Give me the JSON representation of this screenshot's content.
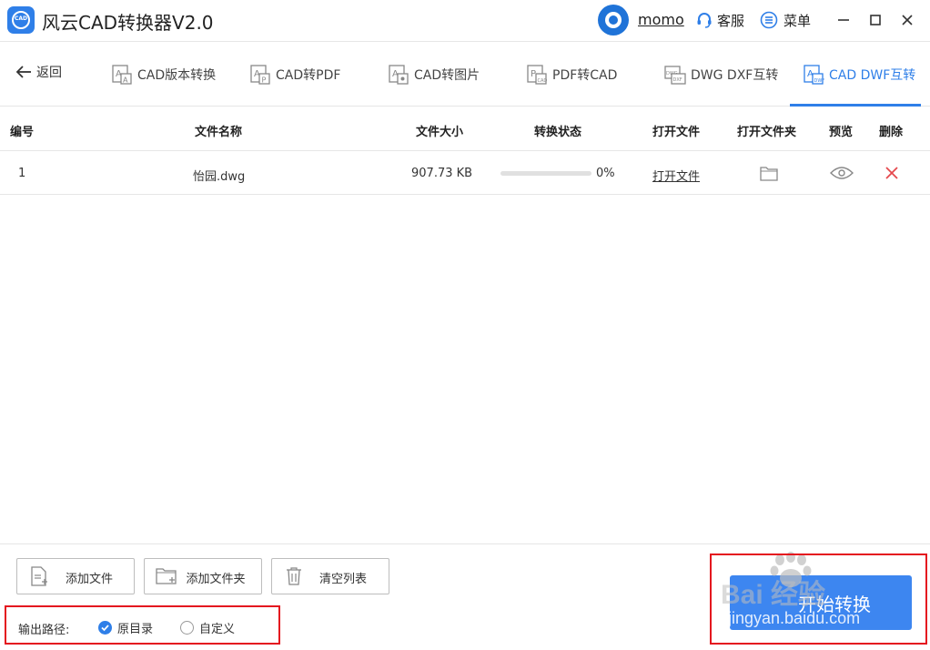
{
  "app": {
    "title": "风云CAD转换器V2.0",
    "logo_text": "CAD",
    "username": "momo",
    "service_label": "客服",
    "menu_label": "菜单",
    "accent_color": "#2f7fe8"
  },
  "nav": {
    "back_label": "返回",
    "tabs": [
      {
        "label": "CAD版本转换",
        "icon": "cad-version-icon",
        "active": false
      },
      {
        "label": "CAD转PDF",
        "icon": "cad-to-pdf-icon",
        "active": false
      },
      {
        "label": "CAD转图片",
        "icon": "cad-to-image-icon",
        "active": false
      },
      {
        "label": "PDF转CAD",
        "icon": "pdf-to-cad-icon",
        "active": false
      },
      {
        "label": "DWG DXF互转",
        "icon": "dwg-dxf-icon",
        "active": false
      },
      {
        "label": "CAD DWF互转",
        "icon": "cad-dwf-icon",
        "active": true
      }
    ]
  },
  "table": {
    "headers": {
      "index": "编号",
      "name": "文件名称",
      "size": "文件大小",
      "status": "转换状态",
      "open_file": "打开文件",
      "open_folder": "打开文件夹",
      "preview": "预览",
      "delete": "删除"
    },
    "rows": [
      {
        "index": "1",
        "name": "怡园.dwg",
        "size": "907.73 KB",
        "progress_text": "0%",
        "progress": 0,
        "open_file": "打开文件"
      }
    ]
  },
  "actions": {
    "add_file": "添加文件",
    "add_folder": "添加文件夹",
    "clear_list": "清空列表",
    "start": "开始转换"
  },
  "output": {
    "label": "输出路径:",
    "options": [
      {
        "label": "原目录",
        "checked": true
      },
      {
        "label": "自定义",
        "checked": false
      }
    ]
  },
  "watermark": {
    "brand": "Bai 经验",
    "url": "jingyan.baidu.com"
  }
}
